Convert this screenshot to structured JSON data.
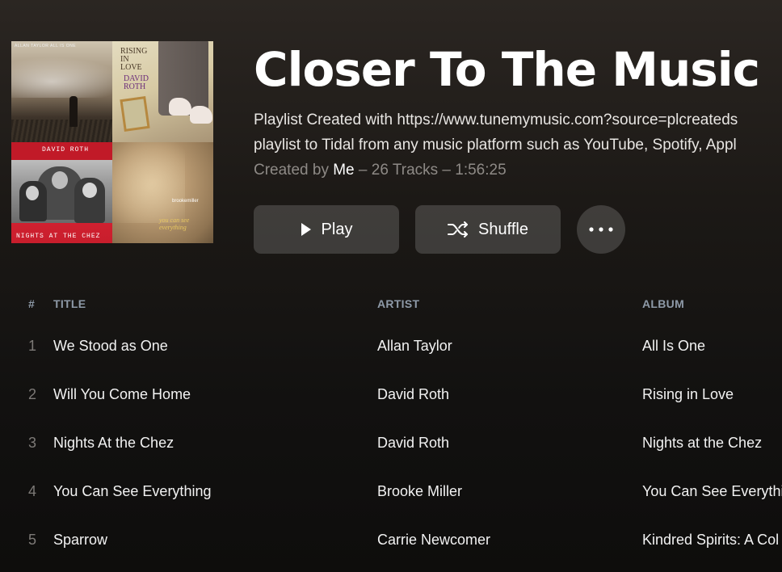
{
  "playlist": {
    "title": "Closer To The Music",
    "description_line1": "Playlist Created with https://www.tunemymusic.com?source=plcreateds",
    "description_line2": "playlist to Tidal from any music platform such as YouTube, Spotify, Appl",
    "created_by_label": "Created by",
    "creator": "Me",
    "stats": "– 26 Tracks – 1:56:25"
  },
  "cover": {
    "tile1_caption": "ALLAN TAYLOR ALL IS ONE",
    "tile2_title": "RISING IN LOVE",
    "tile2_artist": "DAVID ROTH",
    "tile3_top": "DAVID ROTH",
    "tile3_bottom": "NIGHTS AT THE CHEZ",
    "tile4_artist": "brookemiller",
    "tile4_title": "you can see everything"
  },
  "actions": {
    "play_label": "Play",
    "shuffle_label": "Shuffle",
    "more_icon": "more-horizontal-icon"
  },
  "table": {
    "headers": {
      "num": "#",
      "title": "TITLE",
      "artist": "ARTIST",
      "album": "ALBUM"
    },
    "rows": [
      {
        "num": "1",
        "title": "We Stood as One",
        "artist": "Allan Taylor",
        "album": "All Is One"
      },
      {
        "num": "2",
        "title": "Will You Come Home",
        "artist": "David Roth",
        "album": "Rising in Love"
      },
      {
        "num": "3",
        "title": "Nights At the Chez",
        "artist": "David Roth",
        "album": "Nights at the Chez"
      },
      {
        "num": "4",
        "title": "You Can See Everything",
        "artist": "Brooke Miller",
        "album": "You Can See Everythin"
      },
      {
        "num": "5",
        "title": "Sparrow",
        "artist": "Carrie Newcomer",
        "album": "Kindred Spirits: A Col"
      }
    ]
  }
}
